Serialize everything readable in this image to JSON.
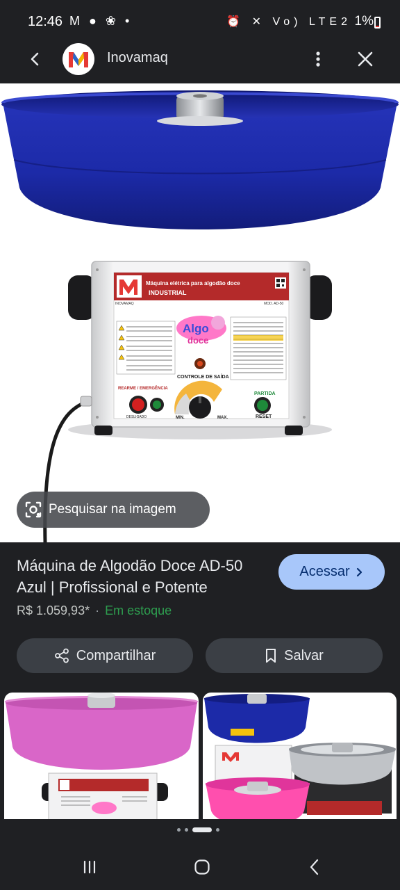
{
  "status_bar": {
    "time": "12:46",
    "left_icons": "M ● ❀ •",
    "right_icons": "⏰ ✕ Vo) LTE2",
    "battery": "1%"
  },
  "app_bar": {
    "site_name": "Inovamaq",
    "logo_letter": "M"
  },
  "hero": {
    "lens_label": "Pesquisar na imagem",
    "machine": {
      "brand": "INOVAMAQ",
      "header_line1": "Máquina elétrica para algodão doce",
      "header_line2": "INDUSTRIAL",
      "model": "MOD. AD-50",
      "logo_line1": "Algo",
      "logo_line2": "doce",
      "control_label": "CONTROLE DE SAÍDA",
      "emergency_label": "REARME / EMERGÊNCIA",
      "start_label": "PARTIDA",
      "reset_label": "RESET",
      "min_label": "MIN.",
      "max_label": "MAX.",
      "off_label": "DESLIGADO"
    }
  },
  "product": {
    "title": "Máquina de Algodão Doce AD-50 Azul | Profissional e Potente",
    "visit_label": "Acessar",
    "price": "R$ 1.059,93*",
    "stock": "Em estoque"
  },
  "actions": {
    "share_label": "Compartilhar",
    "save_label": "Salvar"
  },
  "colors": {
    "bowl_blue": "#1c2aa8",
    "bowl_pink": "#d966c8",
    "accent_blue": "#a8c7fa",
    "stock_green": "#2e9e4f"
  }
}
